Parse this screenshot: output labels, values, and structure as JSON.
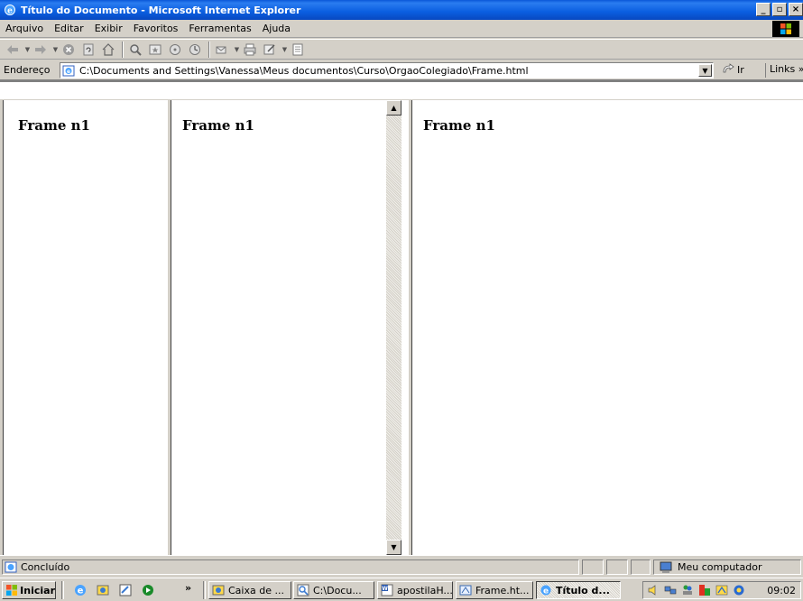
{
  "window": {
    "title": "Título do Documento - Microsoft Internet Explorer",
    "minimize_label": "_",
    "maximize_label": "▫",
    "close_label": "×"
  },
  "menu": {
    "items": [
      "Arquivo",
      "Editar",
      "Exibir",
      "Favoritos",
      "Ferramentas",
      "Ajuda"
    ]
  },
  "toolbar": {
    "icons": [
      "back-icon",
      "forward-icon",
      "stop-icon",
      "refresh-icon",
      "home-icon",
      "search-icon",
      "favorites-icon",
      "media-icon",
      "history-icon",
      "mail-icon",
      "print-icon",
      "edit-icon",
      "discuss-icon"
    ]
  },
  "address": {
    "label": "Endereço",
    "url": "C:\\Documents and Settings\\Vanessa\\Meus documentos\\Curso\\OrgaoColegiado\\Frame.html",
    "go_label": "Ir",
    "links_label": "Links »"
  },
  "frames": [
    {
      "heading": "Frame n1"
    },
    {
      "heading": "Frame n1"
    },
    {
      "heading": "Frame n1"
    }
  ],
  "status": {
    "text": "Concluído",
    "zone": "Meu computador"
  },
  "taskbar": {
    "start_label": "Iniciar",
    "overflow_label": "»",
    "tasks": [
      {
        "label": "Caixa de ...",
        "icon": "outlook-icon"
      },
      {
        "label": "C:\\Docu...",
        "icon": "folder-search-icon"
      },
      {
        "label": "apostilaH...",
        "icon": "word-icon"
      },
      {
        "label": "Frame.ht...",
        "icon": "frontpage-icon"
      },
      {
        "label": "Título d...",
        "icon": "ie-icon",
        "active": true
      }
    ],
    "clock": "09:02"
  },
  "colors": {
    "titlebar": "#0a5ee0",
    "chrome": "#d4d0c8",
    "content": "#ffffff"
  }
}
